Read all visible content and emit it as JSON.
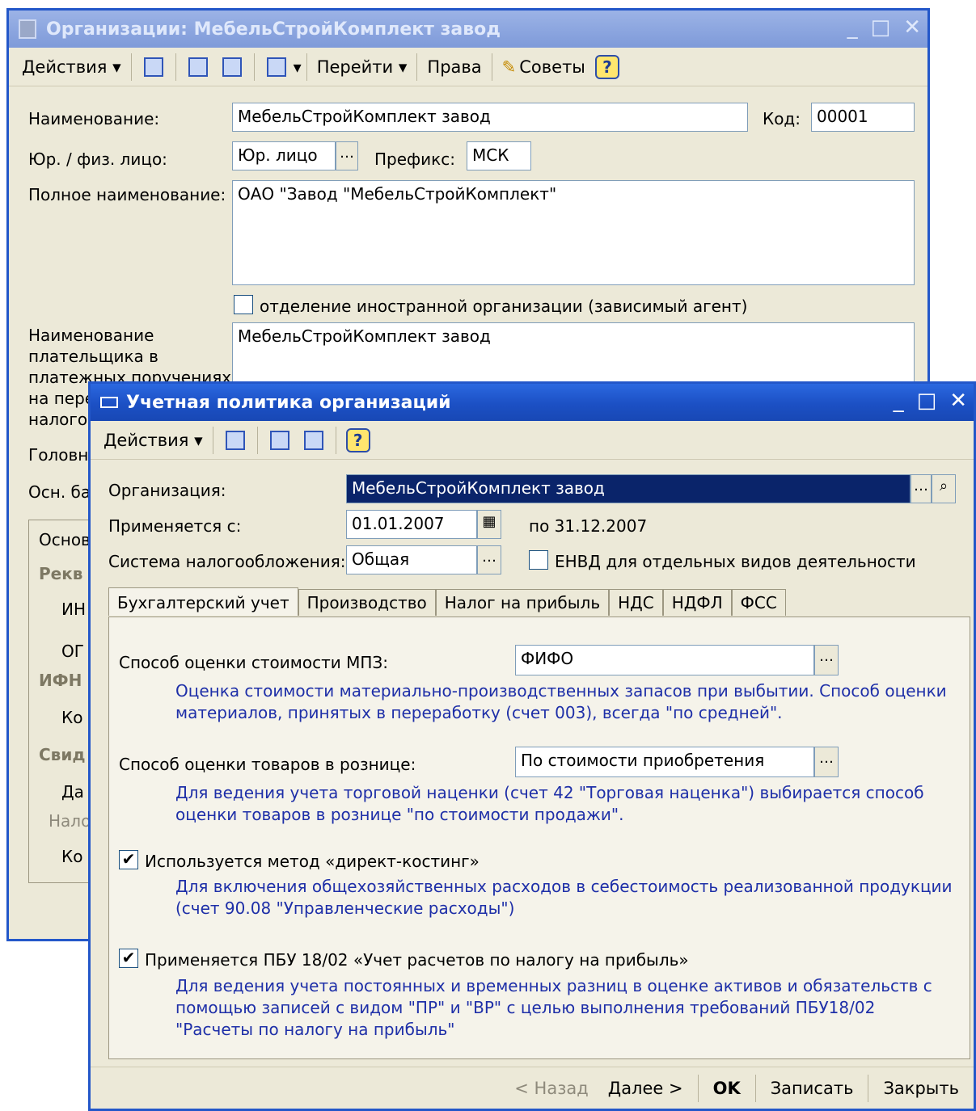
{
  "back": {
    "title": "Организации: МебельСтройКомплект завод",
    "window_controls": [
      "_",
      "□",
      "✕"
    ],
    "toolbar": {
      "actions": "Действия",
      "goto": "Перейти",
      "rights": "Права",
      "tips": "Советы",
      "help": "?"
    },
    "name_label": "Наименование:",
    "name_value": "МебельСтройКомплект завод",
    "code_label": "Код:",
    "code_value": "00001",
    "entity_label": "Юр. / физ. лицо:",
    "entity_value": "Юр. лицо",
    "prefix_label": "Префикс:",
    "prefix_value": "МСК",
    "fullname_label": "Полное наименование:",
    "fullname_value": "ОАО \"Завод \"МебельСтройКомплект\"",
    "foreign_label": "отделение иностранной организации (зависимый агент)",
    "payer_label_1": "Наименование",
    "payer_label_2": "плательщика в",
    "payer_label_3": "платежных поручениях",
    "payer_label_4": "на пере",
    "payer_label_5": "налогов",
    "payer_value": "МебельСтройКомплект завод",
    "head_label": "Головн",
    "bank_label": "Осн. ба",
    "group_title": "Основ",
    "section_req": "Рекв",
    "inn": "ИН",
    "ogrn": "ОГ",
    "section_ifns": "ИФН",
    "code_ifns": "Ко",
    "section_cert": "Свид",
    "date": "Да",
    "tax": "Нало",
    "code2": "Ко"
  },
  "front": {
    "title": "Учетная политика организаций",
    "window_controls": [
      "_",
      "□",
      "✕"
    ],
    "toolbar": {
      "actions": "Действия",
      "help": "?"
    },
    "org_label": "Организация:",
    "org_value": "МебельСтройКомплект завод",
    "applies_label": "Применяется с:",
    "date_from": "01.01.2007",
    "date_to": "по 31.12.2007",
    "tax_system_label": "Система налогообложения:",
    "tax_system_value": "Общая",
    "envd_label": "ЕНВД для отдельных видов деятельности",
    "tabs": [
      "Бухгалтерский учет",
      "Производство",
      "Налог на прибыль",
      "НДС",
      "НДФЛ",
      "ФСС"
    ],
    "mpz_label": "Способ оценки стоимости МПЗ:",
    "mpz_value": "ФИФО",
    "mpz_hint_1": "Оценка стоимости материально-производственных запасов при выбытии. Способ оценки",
    "mpz_hint_2": "материалов, принятых в переработку (счет 003), всегда \"по средней\".",
    "retail_label": "Способ оценки товаров в рознице:",
    "retail_value": "По стоимости приобретения",
    "retail_hint_1": "Для ведения учета торговой наценки (счет 42 \"Торговая наценка\") выбирается способ",
    "retail_hint_2": "оценки товаров в рознице \"по стоимости продажи\".",
    "direct_label": "Используется метод «директ-костинг»",
    "direct_checked": true,
    "direct_hint_1": "Для включения общехозяйственных расходов в себестоимость реализованной продукции",
    "direct_hint_2": "(счет 90.08 \"Управленческие расходы\")",
    "pbu_label": "Применяется ПБУ 18/02 «Учет расчетов по налогу на прибыль»",
    "pbu_checked": true,
    "pbu_hint_1": "Для ведения учета постоянных и временных разниц в оценке активов и обязательств с",
    "pbu_hint_2": "помощью записей с видом \"ПР\" и \"ВР\" с целью выполнения требований ПБУ18/02",
    "pbu_hint_3": "\"Расчеты по налогу на прибыль\"",
    "buttons": {
      "back": "< Назад",
      "next": "Далее >",
      "ok": "OK",
      "save": "Записать",
      "close": "Закрыть"
    }
  },
  "colors": {
    "title_active": "#2B68E0",
    "window_bg": "#ECE9D8",
    "hint_text": "#1E2FA8",
    "selection": "#0A246A"
  }
}
